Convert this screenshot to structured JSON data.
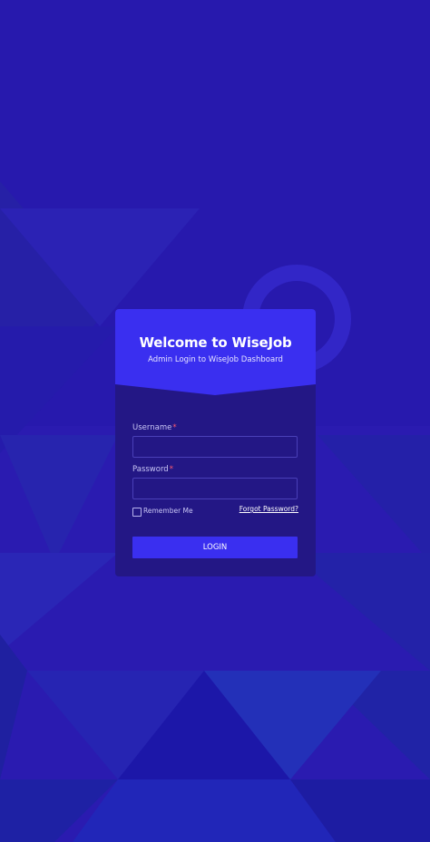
{
  "colors": {
    "background": "#2a1bb0",
    "card": "#231785",
    "header": "#3a2ff0",
    "accent_required": "#ff5a6e"
  },
  "header": {
    "title": "Welcome to WiseJob",
    "subtitle": "Admin Login to WiseJob Dashboard"
  },
  "form": {
    "username": {
      "label": "Username",
      "required_mark": "*",
      "value": "",
      "placeholder": ""
    },
    "password": {
      "label": "Password",
      "required_mark": "*",
      "value": "",
      "placeholder": ""
    },
    "remember_me": {
      "label": "Remember Me",
      "checked": false
    },
    "forgot_password": "Forgot Password?",
    "submit_label": "LOGIN"
  }
}
